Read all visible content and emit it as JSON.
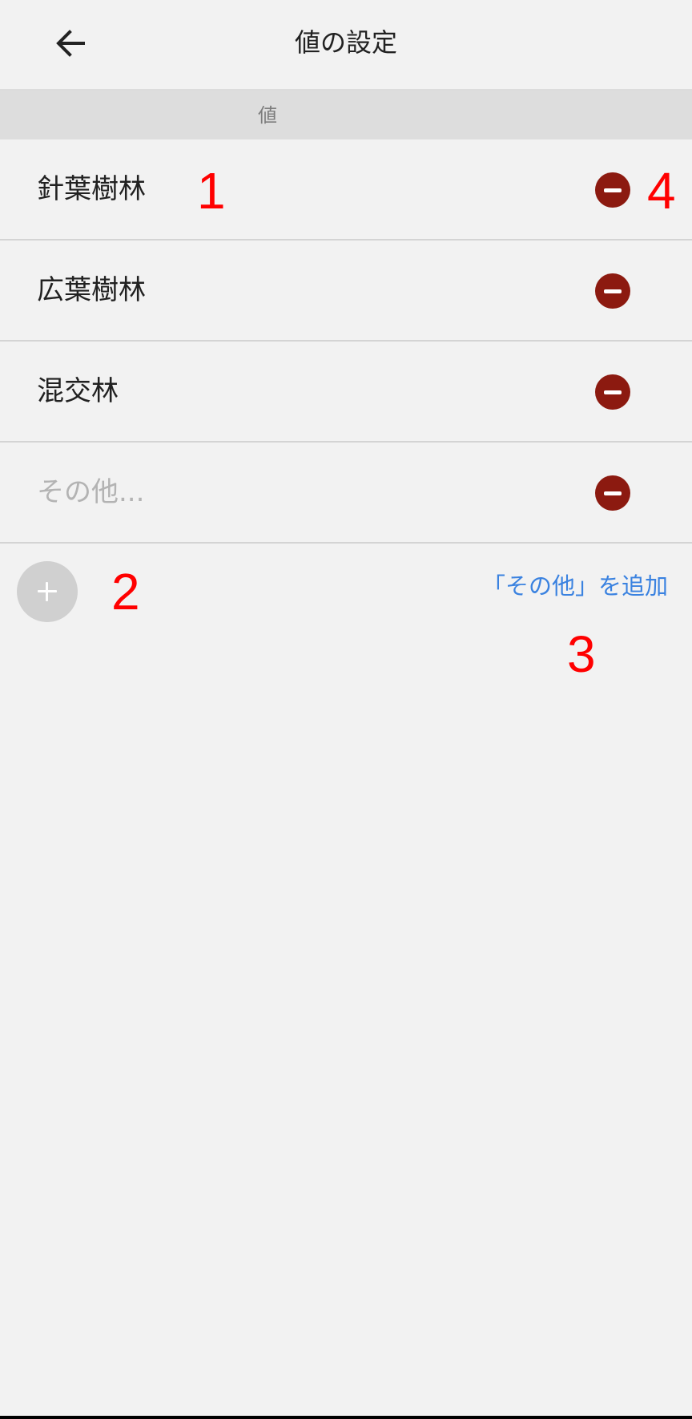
{
  "header": {
    "title": "値の設定",
    "back_icon": "arrow-left-icon"
  },
  "section": {
    "label": "値"
  },
  "values": [
    {
      "text": "針葉樹林",
      "remove_icon": "minus-circle-icon"
    },
    {
      "text": "広葉樹林",
      "remove_icon": "minus-circle-icon"
    },
    {
      "text": "混交林",
      "remove_icon": "minus-circle-icon"
    }
  ],
  "other_field": {
    "value": "",
    "placeholder": "その他..."
  },
  "actions": {
    "add_icon": "plus-icon",
    "add_other_label": "「その他」を追加"
  },
  "annotations": [
    "1",
    "2",
    "3",
    "4"
  ],
  "colors": {
    "background": "#f2f2f2",
    "section_header": "#dddddd",
    "remove_button": "#8c1a10",
    "add_button": "#d0d0d0",
    "link": "#3a82e0",
    "annotation": "#ff0000"
  }
}
